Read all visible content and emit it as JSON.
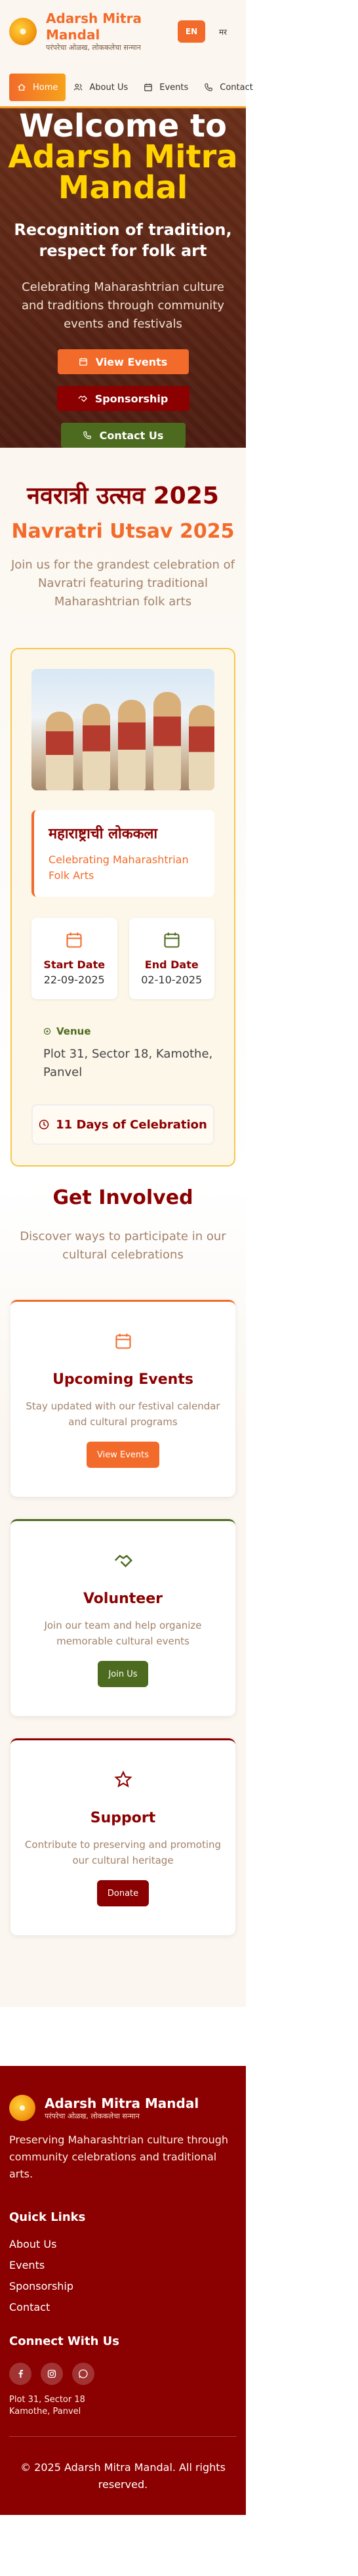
{
  "header": {
    "brand_name": "Adarsh Mitra Mandal",
    "brand_tag": "परंपरेचा ओळख, लोककलेचा सन्मान",
    "lang_en": "EN",
    "lang_mr": "मर",
    "nav": [
      {
        "label": "Home",
        "icon": "home-icon"
      },
      {
        "label": "About Us",
        "icon": "users-icon"
      },
      {
        "label": "Events",
        "icon": "calendar-icon"
      },
      {
        "label": "Contact",
        "icon": "phone-icon"
      }
    ]
  },
  "hero": {
    "title_line1": "Welcome to",
    "title_line2": "Adarsh Mitra Mandal",
    "subtitle": "Recognition of tradition, respect for folk art",
    "description": "Celebrating Maharashtrian culture and traditions through community events and festivals",
    "btn_view": "View Events",
    "btn_sponsor": "Sponsorship",
    "btn_contact": "Contact Us"
  },
  "festival": {
    "title_mr": "नवरात्री उत्सव 2025",
    "title_en": "Navratri Utsav 2025",
    "description": "Join us for the grandest celebration of Navratri featuring traditional Maharashtrian folk arts",
    "card_title": "महाराष्ट्राची लोककला",
    "card_subtitle": "Celebrating Maharashtrian Folk Arts",
    "start_label": "Start Date",
    "start_value": "22-09-2025",
    "end_label": "End Date",
    "end_value": "02-10-2025",
    "venue_label": "Venue",
    "venue_text": "Plot 31, Sector 18, Kamothe, Panvel",
    "days_label": "11 Days of Celebration"
  },
  "involved": {
    "title": "Get Involved",
    "description": "Discover ways to participate in our cultural celebrations",
    "cards": [
      {
        "title": "Upcoming Events",
        "desc": "Stay updated with our festival calendar and cultural programs",
        "button": "View Events",
        "icon": "calendar-icon"
      },
      {
        "title": "Volunteer",
        "desc": "Join our team and help organize memorable cultural events",
        "button": "Join Us",
        "icon": "handshake-icon"
      },
      {
        "title": "Support",
        "desc": "Contribute to preserving and promoting our cultural heritage",
        "button": "Donate",
        "icon": "star-icon"
      }
    ]
  },
  "footer": {
    "brand_name": "Adarsh Mitra Mandal",
    "brand_tag": "परंपरेचा ओळख, लोककलेचा सन्मान",
    "about": "Preserving Maharashtrian culture through community celebrations and traditional arts.",
    "quick_links_title": "Quick Links",
    "links": [
      "About Us",
      "Events",
      "Sponsorship",
      "Contact"
    ],
    "connect_title": "Connect With Us",
    "social": [
      "facebook-icon",
      "instagram-icon",
      "whatsapp-icon"
    ],
    "address_line1": "Plot 31, Sector 18",
    "address_line2": "Kamothe, Panvel",
    "copyright": "© 2025 Adarsh Mitra Mandal. All rights reserved."
  },
  "colors": {
    "accent": "#f26b2a",
    "maroon": "#8b0000",
    "green": "#4d6b1e",
    "gold": "#ffd200"
  }
}
